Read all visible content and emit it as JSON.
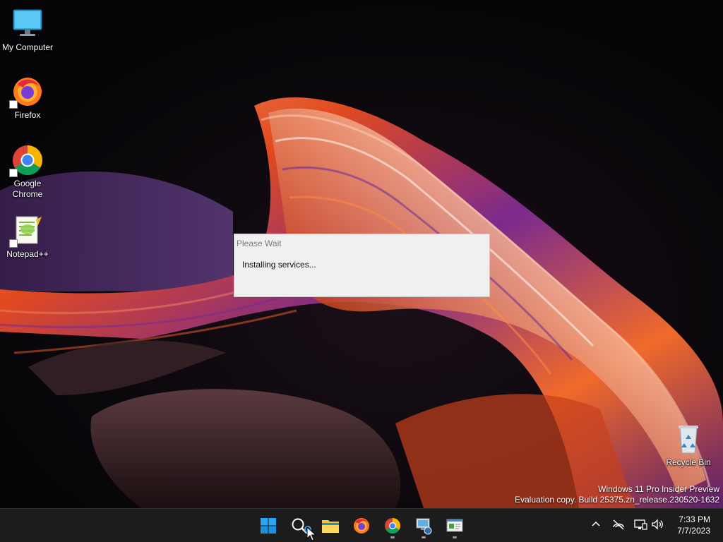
{
  "desktop": {
    "icons": [
      {
        "label": "My Computer",
        "icon": "monitor-icon"
      },
      {
        "label": "Firefox",
        "icon": "firefox-icon"
      },
      {
        "label": "Google\nChrome",
        "icon": "chrome-icon"
      },
      {
        "label": "Notepad++",
        "icon": "notepad-plus-plus-icon"
      },
      {
        "label": "Recycle Bin",
        "icon": "recycle-bin-icon"
      }
    ]
  },
  "dialog": {
    "title": "Please Wait",
    "message": "Installing services..."
  },
  "watermark": {
    "line1": "Windows 11 Pro Insider Preview",
    "line2": "Evaluation copy. Build 25375.zn_release.230520-1632"
  },
  "taskbar": {
    "apps": [
      {
        "icon": "start-windows-icon"
      },
      {
        "icon": "search-icon"
      },
      {
        "icon": "file-explorer-icon"
      },
      {
        "icon": "firefox-icon"
      },
      {
        "icon": "chrome-icon"
      },
      {
        "icon": "network-manager-icon"
      },
      {
        "icon": "console-window-icon"
      }
    ],
    "tray": {
      "icons": [
        "chevron-up-icon",
        "network-disconnected-icon",
        "display-icon",
        "volume-icon"
      ],
      "time": "7:33 PM",
      "date": "7/7/2023"
    }
  },
  "colors": {
    "taskbar": "#1c1c1c",
    "dialog_bg": "#f0f0f0",
    "windows_blue": "#0078d4"
  }
}
